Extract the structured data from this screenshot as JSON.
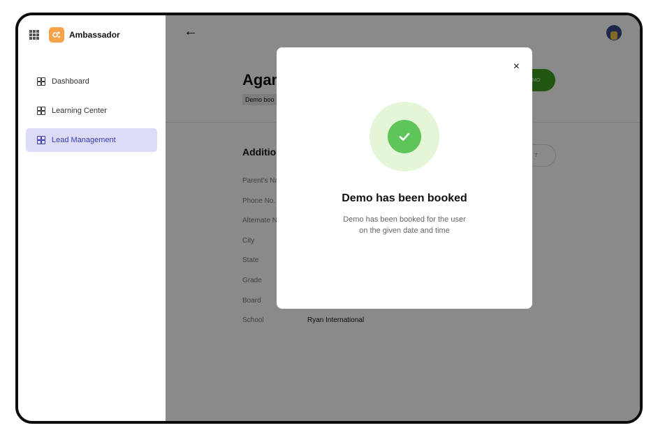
{
  "app": {
    "name": "Ambassador"
  },
  "sidebar": {
    "items": [
      {
        "label": "Dashboard",
        "active": false
      },
      {
        "label": "Learning Center",
        "active": false
      },
      {
        "label": "Lead Management",
        "active": true
      }
    ]
  },
  "lead": {
    "name": "Agam",
    "status": "Demo boo",
    "action_label": "MO",
    "section_title": "Additio",
    "edit_label": "T",
    "fields": [
      {
        "label": "Parent's Na",
        "value": ""
      },
      {
        "label": "Phone No.",
        "value": ""
      },
      {
        "label": "Alternate N",
        "value": ""
      },
      {
        "label": "City",
        "value": ""
      },
      {
        "label": "State",
        "value": ""
      },
      {
        "label": "Grade",
        "value": ""
      },
      {
        "label": "Board",
        "value": ""
      },
      {
        "label": "School",
        "value": "Ryan International"
      }
    ]
  },
  "modal": {
    "title": "Demo has been booked",
    "message_line1": "Demo has been booked for the user",
    "message_line2": "on the given date and time",
    "close_glyph": "×"
  },
  "colors": {
    "accent": "#3a3ab8",
    "active_bg": "#dcdcf6",
    "success": "#5ec55a",
    "success_bg": "#e4f5d8",
    "cta_green": "#3ea024",
    "logo_orange": "#f5a24b"
  },
  "icons": {
    "apps": "grid-icon",
    "logo": "ambassador-logo-icon",
    "nav": "grid-2x2-icon",
    "back": "arrow-left-icon",
    "close": "close-icon",
    "success": "check-circle-icon"
  }
}
